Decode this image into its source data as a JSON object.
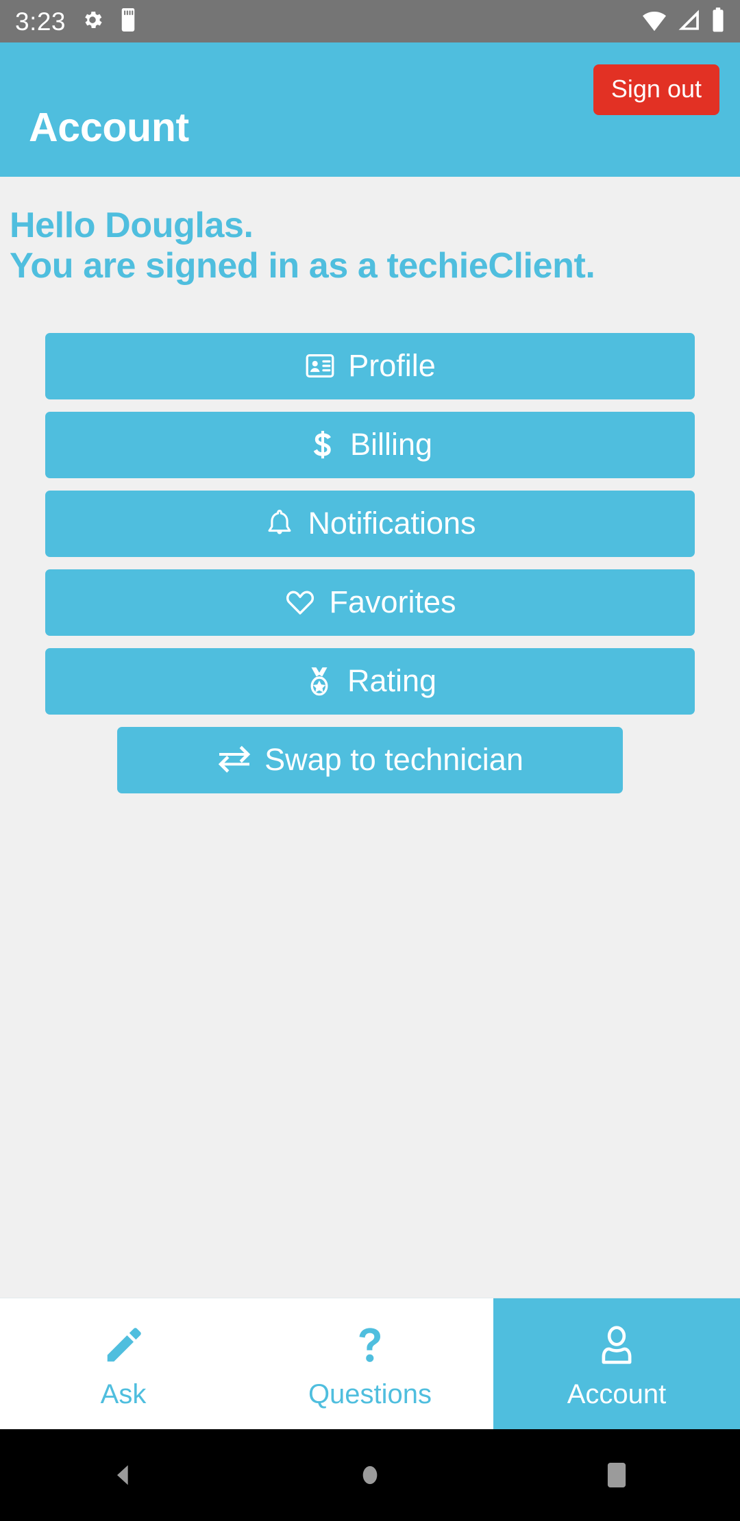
{
  "status_bar": {
    "time": "3:23",
    "left_icons": [
      "settings-gear-icon",
      "sd-card-icon"
    ],
    "right_icons": [
      "wifi-icon",
      "cell-signal-icon",
      "battery-icon"
    ],
    "background": "#757575"
  },
  "header": {
    "title": "Account",
    "sign_out_label": "Sign out",
    "background": "#4FBEDE",
    "sign_out_color": "#E23124"
  },
  "body": {
    "background": "#F0F0F0",
    "accent": "#4FBEDE",
    "greeting_line1": "Hello Douglas.",
    "greeting_line2": "You are signed in as a techieClient.",
    "buttons": [
      {
        "label": "Profile",
        "icon": "id-card-icon"
      },
      {
        "label": "Billing",
        "icon": "dollar-sign-icon"
      },
      {
        "label": "Notifications",
        "icon": "bell-icon"
      },
      {
        "label": "Favorites",
        "icon": "heart-icon"
      },
      {
        "label": "Rating",
        "icon": "medal-icon"
      },
      {
        "label": "Swap to technician",
        "icon": "exchange-arrows-icon"
      }
    ]
  },
  "tab_bar": {
    "tabs": [
      {
        "label": "Ask",
        "icon": "pencil-icon",
        "active": false
      },
      {
        "label": "Questions",
        "icon": "question-mark-icon",
        "active": false
      },
      {
        "label": "Account",
        "icon": "person-icon",
        "active": true
      }
    ]
  },
  "system_nav": {
    "buttons": [
      "back-icon",
      "home-icon",
      "recents-icon"
    ]
  }
}
